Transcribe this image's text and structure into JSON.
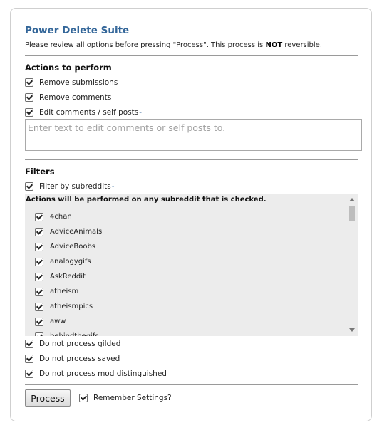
{
  "header": {
    "title": "Power Delete Suite",
    "subtitle_before": "Please review all options before pressing \"Process\". This process is ",
    "subtitle_bold": "NOT",
    "subtitle_after": " reversible."
  },
  "actions": {
    "heading": "Actions to perform",
    "remove_submissions": "Remove submissions",
    "remove_comments": "Remove comments",
    "edit_comments": "Edit comments / self posts",
    "edit_comments_suffix": "-",
    "edit_text_placeholder": "Enter text to edit comments or self posts to."
  },
  "filters": {
    "heading": "Filters",
    "filter_by_subreddits": "Filter by subreddits",
    "filter_suffix": "-",
    "list_header": "Actions will be performed on any subreddit that is checked.",
    "subreddits": [
      "4chan",
      "AdviceAnimals",
      "AdviceBoobs",
      "analogygifs",
      "AskReddit",
      "atheism",
      "atheismpics",
      "aww",
      "behindthegifs"
    ],
    "do_not_process_gilded": "Do not process gilded",
    "do_not_process_saved": "Do not process saved",
    "do_not_process_mod": "Do not process mod distinguished"
  },
  "footer": {
    "process_button": "Process",
    "remember_settings": "Remember Settings?"
  }
}
